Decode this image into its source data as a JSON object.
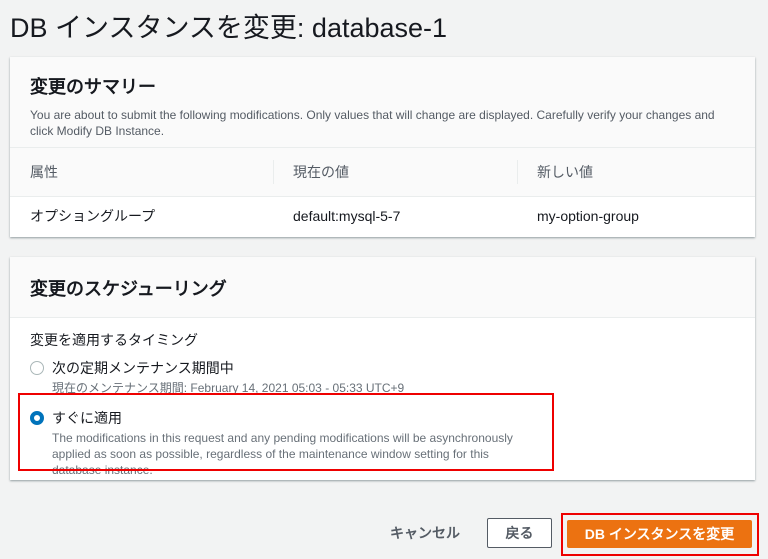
{
  "page": {
    "title": "DB インスタンスを変更: database-1"
  },
  "summary": {
    "heading": "変更のサマリー",
    "description": "You are about to submit the following modifications. Only values that will change are displayed. Carefully verify your changes and click Modify DB Instance.",
    "columns": [
      "属性",
      "現在の値",
      "新しい値"
    ],
    "rows": [
      [
        "オプショングループ",
        "default:mysql-5-7",
        "my-option-group"
      ]
    ]
  },
  "schedule": {
    "heading": "変更のスケジューリング",
    "label": "変更を適用するタイミング",
    "options": [
      {
        "title": "次の定期メンテナンス期間中",
        "sub": "現在のメンテナンス期間: February 14, 2021 05:03 - 05:33 UTC+9",
        "selected": false
      },
      {
        "title": "すぐに適用",
        "sub": "The modifications in this request and any pending modifications will be asynchronously applied as soon as possible, regardless of the maintenance window setting for this database instance.",
        "selected": true
      }
    ]
  },
  "actions": {
    "cancel": "キャンセル",
    "back": "戻る",
    "submit": "DB インスタンスを変更"
  },
  "colors": {
    "accent": "#ec7211",
    "highlight": "#e00000",
    "radio": "#0073bb"
  }
}
